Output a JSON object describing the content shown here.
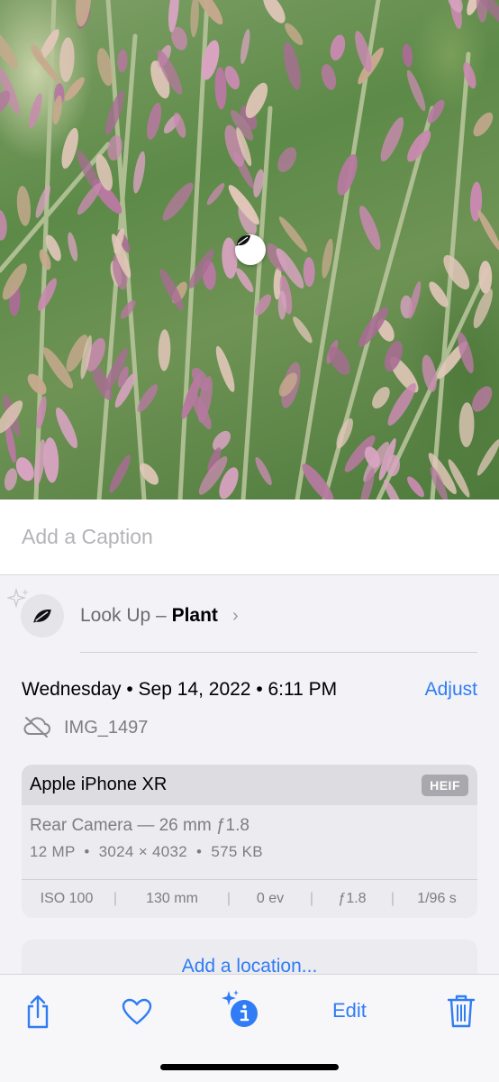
{
  "photo": {
    "badge_icon": "leaf-icon"
  },
  "caption": {
    "placeholder": "Add a Caption"
  },
  "lookup": {
    "prefix": "Look Up – ",
    "subject": "Plant",
    "chevron": "›",
    "icon": "leaf-icon",
    "sparkle_icon": "sparkle-icon"
  },
  "info": {
    "date": "Wednesday • Sep 14, 2022 • 6:11 PM",
    "adjust_label": "Adjust",
    "cloud_icon": "cloud-slash-icon",
    "filename": "IMG_1497"
  },
  "camera": {
    "device": "Apple iPhone XR",
    "format": "HEIF",
    "lens": "Rear Camera — 26 mm ƒ1.8",
    "specs": "12 MP  •  3024 × 4032  •  575 KB",
    "exif": {
      "iso": "ISO 100",
      "focal": "130 mm",
      "ev": "0 ev",
      "aperture": "ƒ1.8",
      "shutter": "1/96 s"
    },
    "separator": "|"
  },
  "location": {
    "label": "Add a location..."
  },
  "toolbar": {
    "edit_label": "Edit"
  },
  "colors": {
    "accent": "#2f7cf6",
    "background": "#f2f2f7"
  }
}
